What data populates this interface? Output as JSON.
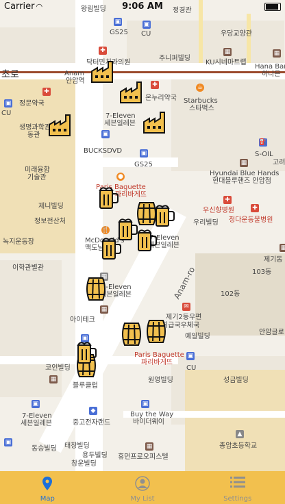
{
  "status_bar": {
    "carrier": "Carrier",
    "time": "9:06 AM"
  },
  "map": {
    "labels": [
      "왕림빌딩",
      "정경관",
      "GS25",
      "CU",
      "우당교양관",
      "닥터민치과의원",
      "주니퍼빌딩",
      "KU시네마트랩",
      "Anam",
      "안암역",
      "Hana Bank",
      "하나은",
      "정문약국",
      "CU",
      "온누리약국",
      "Starbucks",
      "스타벅스",
      "7-Eleven",
      "세븐일레븐",
      "생명과학관",
      "동관",
      "BUCKSDVD",
      "GS25",
      "S-OIL",
      "고려",
      "Hyundai Blue Hands",
      "현대블루핸즈 안암점",
      "미래융합",
      "기술관",
      "Paris Baguette",
      "파리바게뜨",
      "제니빌딩",
      "정보전산처",
      "우신향병원",
      "우리빌딩",
      "정다운동물병원",
      "녹지운동장",
      "McDonald's",
      "맥도날드",
      "7-Eleven",
      "세븐일레븐",
      "제기동",
      "이학관별관",
      "Anam-ro",
      "7-Eleven",
      "세븐일레븐",
      "102동",
      "103동",
      "아이테크",
      "제기2동우편",
      "취급국우체국",
      "예일빌딩",
      "안암글로",
      "Paris Baguette",
      "파리바게뜨",
      "CU",
      "코인빌딩",
      "블루클럽",
      "원영빌딩",
      "성금빌딩",
      "7-Eleven",
      "세븐일레븐",
      "중고전자랜드",
      "Buy the Way",
      "바이더웨이",
      "종암초등학교",
      "동승빌딩",
      "태창빌딩",
      "용두빌딩",
      "창운빌딩",
      "휴먼프로오피스텔"
    ],
    "station_label": "초로"
  },
  "tabs": [
    {
      "label": "Map",
      "icon": "map-pin-icon"
    },
    {
      "label": "My List",
      "icon": "user-icon"
    },
    {
      "label": "Settings",
      "icon": "list-icon"
    }
  ],
  "colors": {
    "tabbar": "#f2c04e",
    "active": "#1e6fd9",
    "inactive": "#8f8f8f"
  }
}
